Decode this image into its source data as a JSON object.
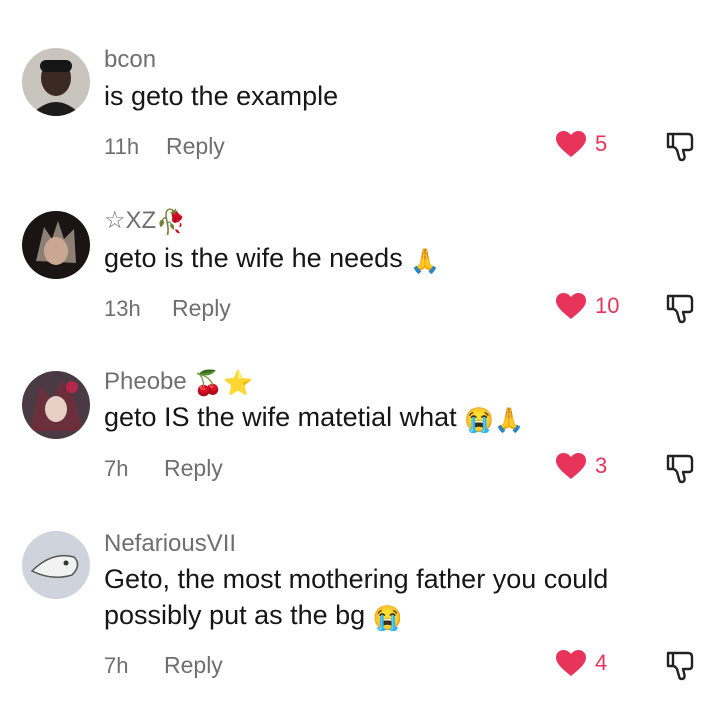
{
  "comments": [
    {
      "username": "bcon",
      "text": "is geto the example",
      "time": "11h",
      "reply_label": "Reply",
      "likes": "5",
      "avatar_icon": "avatar-dark-person-icon"
    },
    {
      "username": "☆XZ",
      "username_emoji": "🥀",
      "text": "geto is the wife he needs",
      "text_emoji": "🙏",
      "time": "13h",
      "reply_label": "Reply",
      "likes": "10",
      "avatar_icon": "avatar-anime-icon"
    },
    {
      "username": "Pheobe",
      "username_emoji": "🍒⭐",
      "text": "geto IS the wife matetial what",
      "text_emoji": "😭🙏",
      "time": "7h",
      "reply_label": "Reply",
      "likes": "3",
      "avatar_icon": "avatar-anime-icon"
    },
    {
      "username": "NefariousVII",
      "text": "Geto, the most mothering father you could possibly put as the bg",
      "text_emoji": "😭",
      "time": "7h",
      "reply_label": "Reply",
      "likes": "4",
      "avatar_icon": "avatar-sketch-icon"
    }
  ],
  "colors": {
    "like": "#e8335a",
    "meta": "#6f6f6f",
    "text": "#161616"
  }
}
